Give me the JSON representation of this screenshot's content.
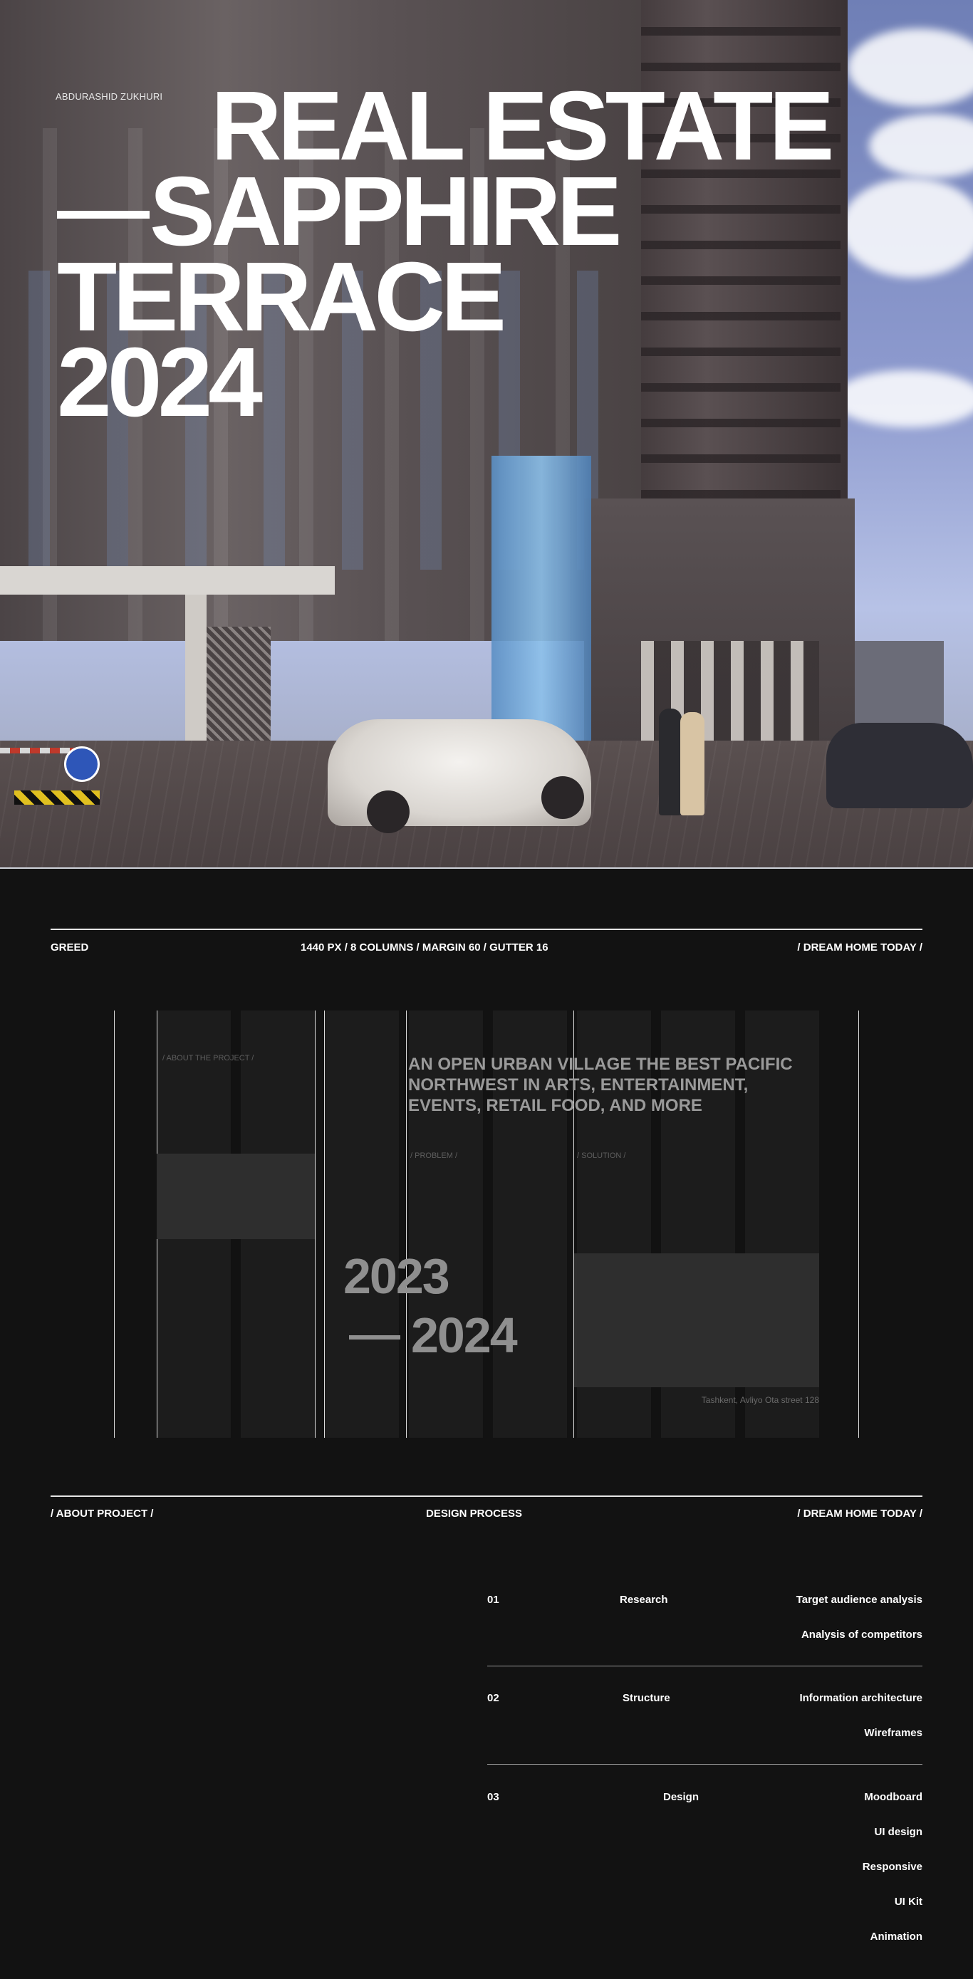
{
  "hero": {
    "author": "ABDURASHID ZUKHURI",
    "title_line1": "REAL ESTATE",
    "title_line2": "SAPPHIRE",
    "title_line3": "TERRACE",
    "title_line4": "2024"
  },
  "grid_meta": {
    "left": "GREED",
    "center": "1440 PX / 8 COLUMNS / MARGIN 60 / GUTTER 16",
    "right": "/ DREAM HOME TODAY /"
  },
  "grid_preview": {
    "about_label": "/ ABOUT THE PROJECT /",
    "intro": "AN OPEN URBAN VILLAGE THE BEST PACIFIC NORTHWEST IN ARTS, ENTERTAINMENT, EVENTS, RETAIL FOOD, AND MORE",
    "problem_label": "/ PROBLEM /",
    "solution_label": "/ SOLUTION /",
    "year_start": "2023",
    "year_end": "2024",
    "address": "Tashkent, Avliyo Ota street 128"
  },
  "process_meta": {
    "left": "/ ABOUT PROJECT /",
    "center": "DESIGN PROCESS",
    "right": "/ DREAM HOME TODAY /"
  },
  "process": [
    {
      "num": "01",
      "stage": "Research",
      "items": [
        "Target audience analysis",
        "Analysis of competitors"
      ]
    },
    {
      "num": "02",
      "stage": "Structure",
      "items": [
        "Information architecture",
        "Wireframes"
      ]
    },
    {
      "num": "03",
      "stage": "Design",
      "items": [
        "Moodboard",
        "UI design",
        "Responsive",
        "UI Kit",
        "Animation"
      ]
    }
  ],
  "colors": {
    "background": "#121212",
    "text": "#ffffff",
    "grid_column": "#1c1c1c",
    "grid_block": "#2e2e2e",
    "muted_text": "#9a9a9a"
  }
}
